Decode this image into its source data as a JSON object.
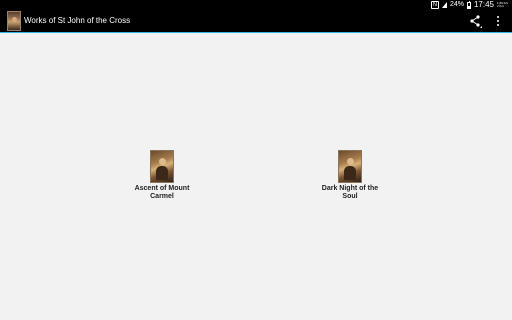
{
  "status_bar": {
    "nfc_label": "N",
    "battery_percent": "24%",
    "battery_level": 0.24,
    "time": "17:45",
    "info_line1": "1,69 K/s",
    "info_line2": "2 K/s"
  },
  "action_bar": {
    "title": "Works of St John of the Cross",
    "share_icon": "share-icon",
    "overflow_icon": "more-vert-icon"
  },
  "colors": {
    "status_bar_bg": "#000000",
    "action_bar_bg": "#000000",
    "accent": "#33b5e5",
    "content_bg": "#f2f2f2"
  },
  "books": [
    {
      "label_line1": "Ascent of Mount",
      "label_line2": "Carmel"
    },
    {
      "label_line1": "Dark Night of the",
      "label_line2": "Soul"
    }
  ]
}
